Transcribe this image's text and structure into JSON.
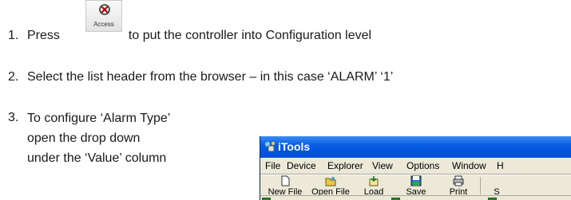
{
  "steps": [
    {
      "number": "1.",
      "before": "Press",
      "after": "to put the controller into Configuration level"
    },
    {
      "number": "2.",
      "text": "Select the list header from the browser – in this case ‘ALARM’ ‘1’"
    },
    {
      "number": "3.",
      "text": "To configure ‘Alarm Type’ open the drop down under the ‘Value’ column"
    }
  ],
  "access_button": {
    "label": "Access",
    "icon": "access-icon"
  },
  "window": {
    "title": "iTools",
    "menu": [
      "File",
      "Device",
      "Explorer",
      "View",
      "Options",
      "Window",
      "H"
    ],
    "toolbar": [
      {
        "label": "New File",
        "icon": "new-file-icon"
      },
      {
        "label": "Open File",
        "icon": "open-file-icon"
      },
      {
        "label": "Load",
        "icon": "load-icon"
      },
      {
        "label": "Save",
        "icon": "save-icon"
      },
      {
        "label": "Print",
        "icon": "print-icon"
      },
      {
        "label": "S",
        "icon": ""
      }
    ],
    "colors": {
      "titlebar": "#0054e3",
      "face": "#ece9d8"
    }
  }
}
